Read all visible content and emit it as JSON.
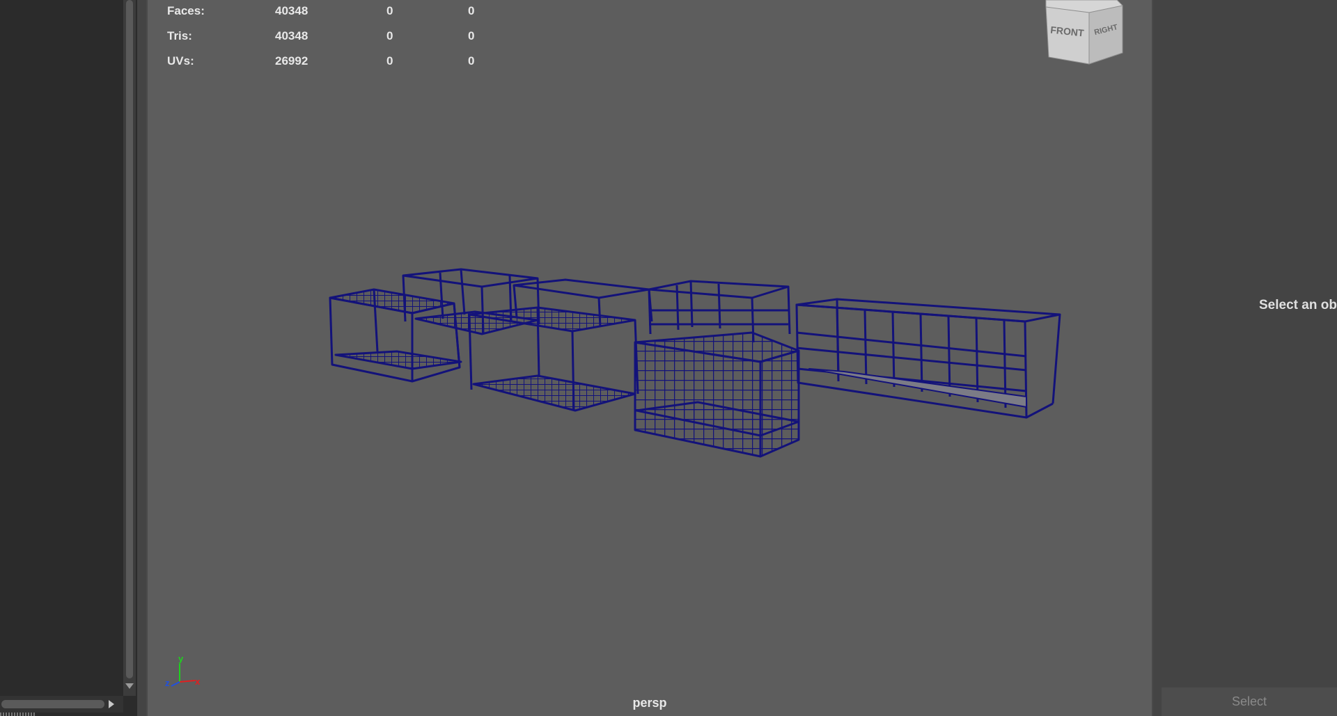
{
  "hud": {
    "rows": [
      {
        "label": "Faces:",
        "c1": "40348",
        "c2": "0",
        "c3": "0"
      },
      {
        "label": "Tris:",
        "c1": "40348",
        "c2": "0",
        "c3": "0"
      },
      {
        "label": "UVs:",
        "c1": "26992",
        "c2": "0",
        "c3": "0"
      }
    ]
  },
  "viewcube": {
    "front_label": "FRONT",
    "right_label": "RIGHT"
  },
  "axis": {
    "x": "x",
    "y": "y",
    "z": "z"
  },
  "viewport": {
    "camera_label": "persp"
  },
  "attribute_panel": {
    "message": "Select an ob",
    "select_button": "Select"
  },
  "colors": {
    "viewport_bg": "#5d5d5d",
    "wireframe": "#13127a",
    "panel_bg": "#444444",
    "outliner_bg": "#2b2b2b"
  },
  "icons": [
    "scroll-down-arrow-icon",
    "scroll-right-arrow-icon",
    "axis-gizmo-icon",
    "viewcube-icon"
  ]
}
